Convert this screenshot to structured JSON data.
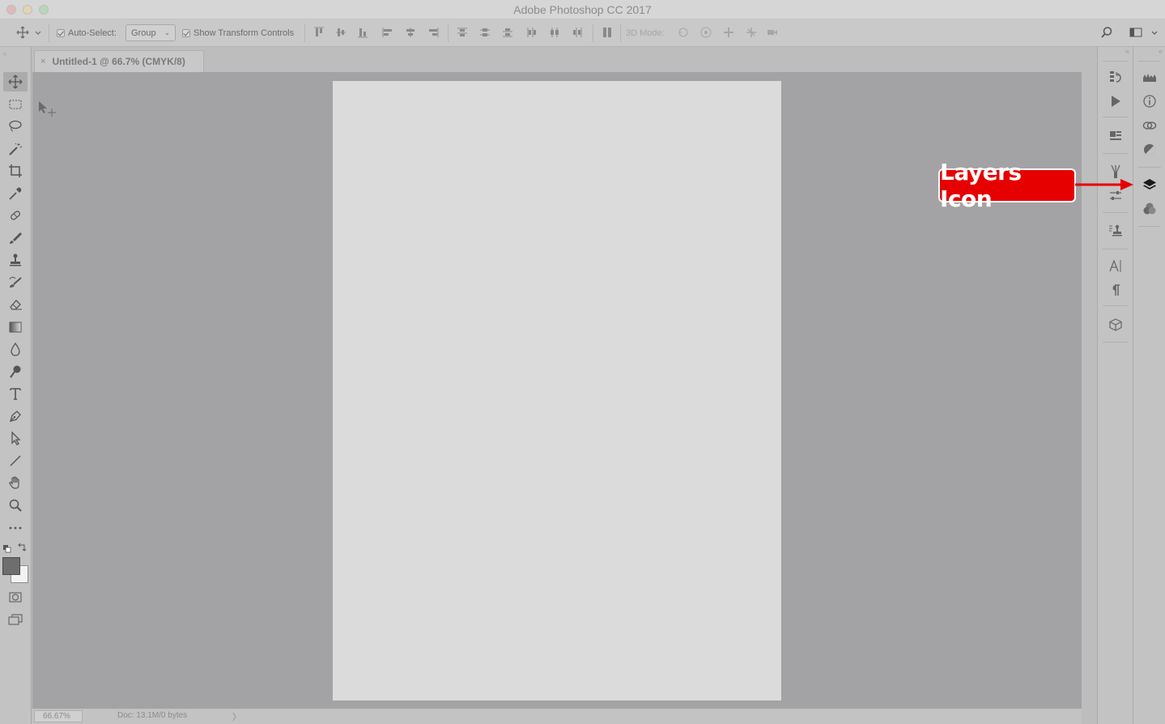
{
  "window": {
    "title": "Adobe Photoshop CC 2017"
  },
  "options_bar": {
    "auto_select_label": "Auto-Select:",
    "auto_select_value": "Group",
    "show_transform_label": "Show Transform Controls",
    "mode_3d_label": "3D Mode:"
  },
  "document_tab": {
    "close_glyph": "×",
    "label": "Untitled-1 @ 66.7% (CMYK/8)"
  },
  "status_bar": {
    "zoom": "66.67%",
    "doc_info": "Doc: 13.1M/0 bytes",
    "arrow": "〉"
  },
  "tools": [
    "move-tool-icon",
    "marquee-tool-icon",
    "lasso-tool-icon",
    "magic-wand-tool-icon",
    "crop-tool-icon",
    "eyedropper-tool-icon",
    "healing-brush-tool-icon",
    "brush-tool-icon",
    "clone-stamp-tool-icon",
    "history-brush-tool-icon",
    "eraser-tool-icon",
    "gradient-tool-icon",
    "blur-tool-icon",
    "dodge-tool-icon",
    "type-tool-icon",
    "pen-tool-icon",
    "path-selection-tool-icon",
    "line-tool-icon",
    "hand-tool-icon",
    "zoom-tool-icon",
    "edit-toolbar-icon"
  ],
  "annotation": {
    "label": "Layers Icon",
    "color": "#e60000"
  },
  "colors": {
    "canvas_bg": "#a3a2a4",
    "document": "#dbdbdb",
    "foreground": "#6e6e6e",
    "background": "#f2f2f2"
  }
}
